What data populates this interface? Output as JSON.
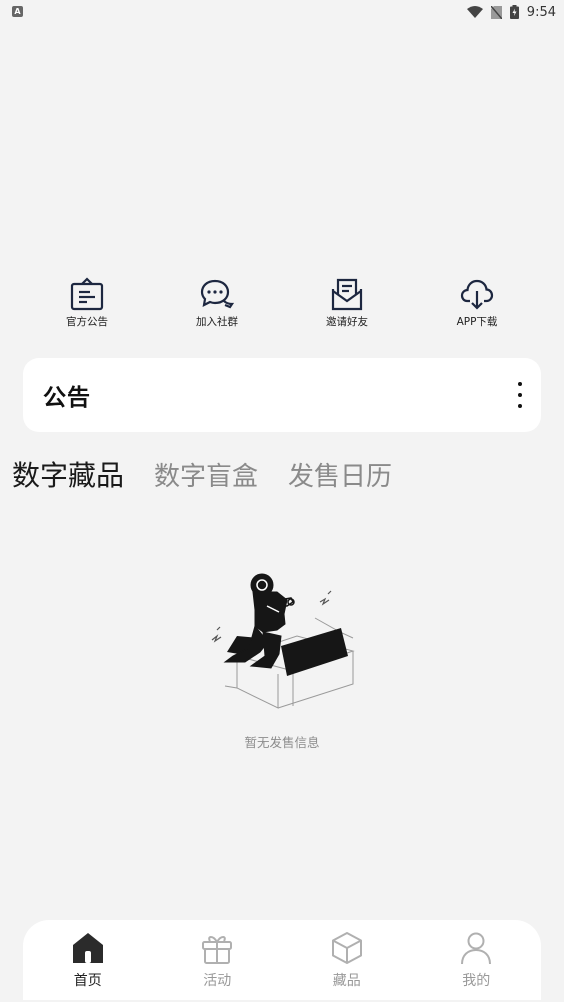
{
  "status_bar": {
    "time": "9:54",
    "left_icon": "A"
  },
  "quick_links": [
    {
      "label": "官方公告",
      "icon": "announcement-icon"
    },
    {
      "label": "加入社群",
      "icon": "chat-icon"
    },
    {
      "label": "邀请好友",
      "icon": "invite-mail-icon"
    },
    {
      "label": "APP下载",
      "icon": "cloud-download-icon"
    }
  ],
  "notice": {
    "title": "公告"
  },
  "tabs": [
    {
      "label": "数字藏品",
      "active": true
    },
    {
      "label": "数字盲盒",
      "active": false
    },
    {
      "label": "发售日历",
      "active": false
    }
  ],
  "empty_state": {
    "text": "暂无发售信息"
  },
  "bottom_nav": [
    {
      "label": "首页",
      "icon": "home-icon",
      "active": true
    },
    {
      "label": "活动",
      "icon": "gift-icon",
      "active": false
    },
    {
      "label": "藏品",
      "icon": "cube-icon",
      "active": false
    },
    {
      "label": "我的",
      "icon": "user-icon",
      "active": false
    }
  ],
  "colors": {
    "background": "#f3f3f3",
    "card": "#ffffff",
    "text_primary": "#1a1a1a",
    "text_muted": "#8a8a8a",
    "icon_dark": "#1d2740"
  }
}
